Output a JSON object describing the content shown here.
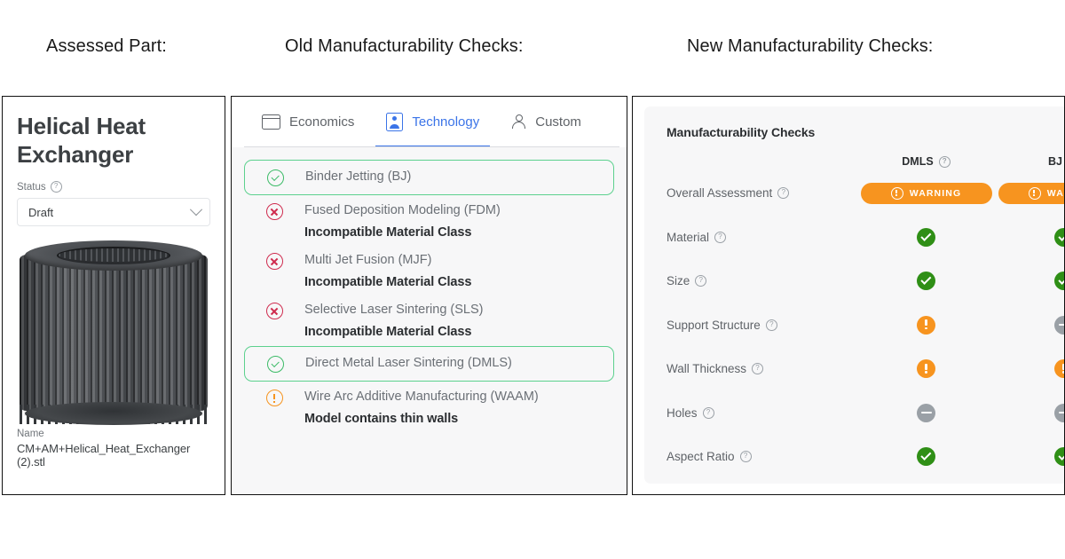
{
  "captions": {
    "left": "Assessed Part:",
    "middle": "Old Manufacturability Checks:",
    "right": "New Manufacturability Checks:"
  },
  "left_panel": {
    "part_title": "Helical Heat Exchanger",
    "status_label": "Status",
    "status_value": "Draft",
    "name_label": "Name",
    "name_value": "CM+AM+Helical_Heat_Exchanger (2).stl",
    "render_alt": "finned-cylinder-heat-exchanger-3d-render"
  },
  "middle_panel": {
    "tabs": [
      {
        "label": "Economics",
        "icon": "card-icon",
        "active": false
      },
      {
        "label": "Technology",
        "icon": "image-badge-icon",
        "active": true
      },
      {
        "label": "Custom",
        "icon": "person-icon",
        "active": false
      }
    ],
    "rows": [
      {
        "name": "Binder Jetting (BJ)",
        "sub": "",
        "status": "ok",
        "highlighted": true
      },
      {
        "name": "Fused Deposition Modeling (FDM)",
        "sub": "Incompatible Material Class",
        "status": "no",
        "highlighted": false
      },
      {
        "name": "Multi Jet Fusion (MJF)",
        "sub": "Incompatible Material Class",
        "status": "no",
        "highlighted": false
      },
      {
        "name": "Selective Laser Sintering (SLS)",
        "sub": "Incompatible Material Class",
        "status": "no",
        "highlighted": false
      },
      {
        "name": "Direct Metal Laser Sintering (DMLS)",
        "sub": "",
        "status": "ok",
        "highlighted": true
      },
      {
        "name": "Wire Arc Additive Manufacturing (WAAM)",
        "sub": "Model contains thin walls",
        "status": "warn",
        "highlighted": false
      }
    ]
  },
  "right_panel": {
    "title": "Manufacturability Checks",
    "columns": [
      "DMLS",
      "BJ"
    ],
    "rows": [
      {
        "label": "Overall Assessment",
        "type": "pill",
        "dmls": "WARNING",
        "bj": "WARNING"
      },
      {
        "label": "Material",
        "type": "icon",
        "dmls": "ok",
        "bj": "ok"
      },
      {
        "label": "Size",
        "type": "icon",
        "dmls": "ok",
        "bj": "ok"
      },
      {
        "label": "Support Structure",
        "type": "icon",
        "dmls": "warn",
        "bj": "na"
      },
      {
        "label": "Wall Thickness",
        "type": "icon",
        "dmls": "warn",
        "bj": "warn"
      },
      {
        "label": "Holes",
        "type": "icon",
        "dmls": "na",
        "bj": "na"
      },
      {
        "label": "Aspect Ratio",
        "type": "icon",
        "dmls": "ok",
        "bj": "ok"
      }
    ]
  },
  "colors": {
    "accent_blue": "#3b74e8",
    "ok_green": "#2f8f16",
    "ok_outline_green": "#3cbb67",
    "warning_orange": "#f7941f",
    "error_red": "#cf2b4e",
    "na_grey": "#9aa0a6",
    "panel_bg": "#f7f7f8"
  }
}
